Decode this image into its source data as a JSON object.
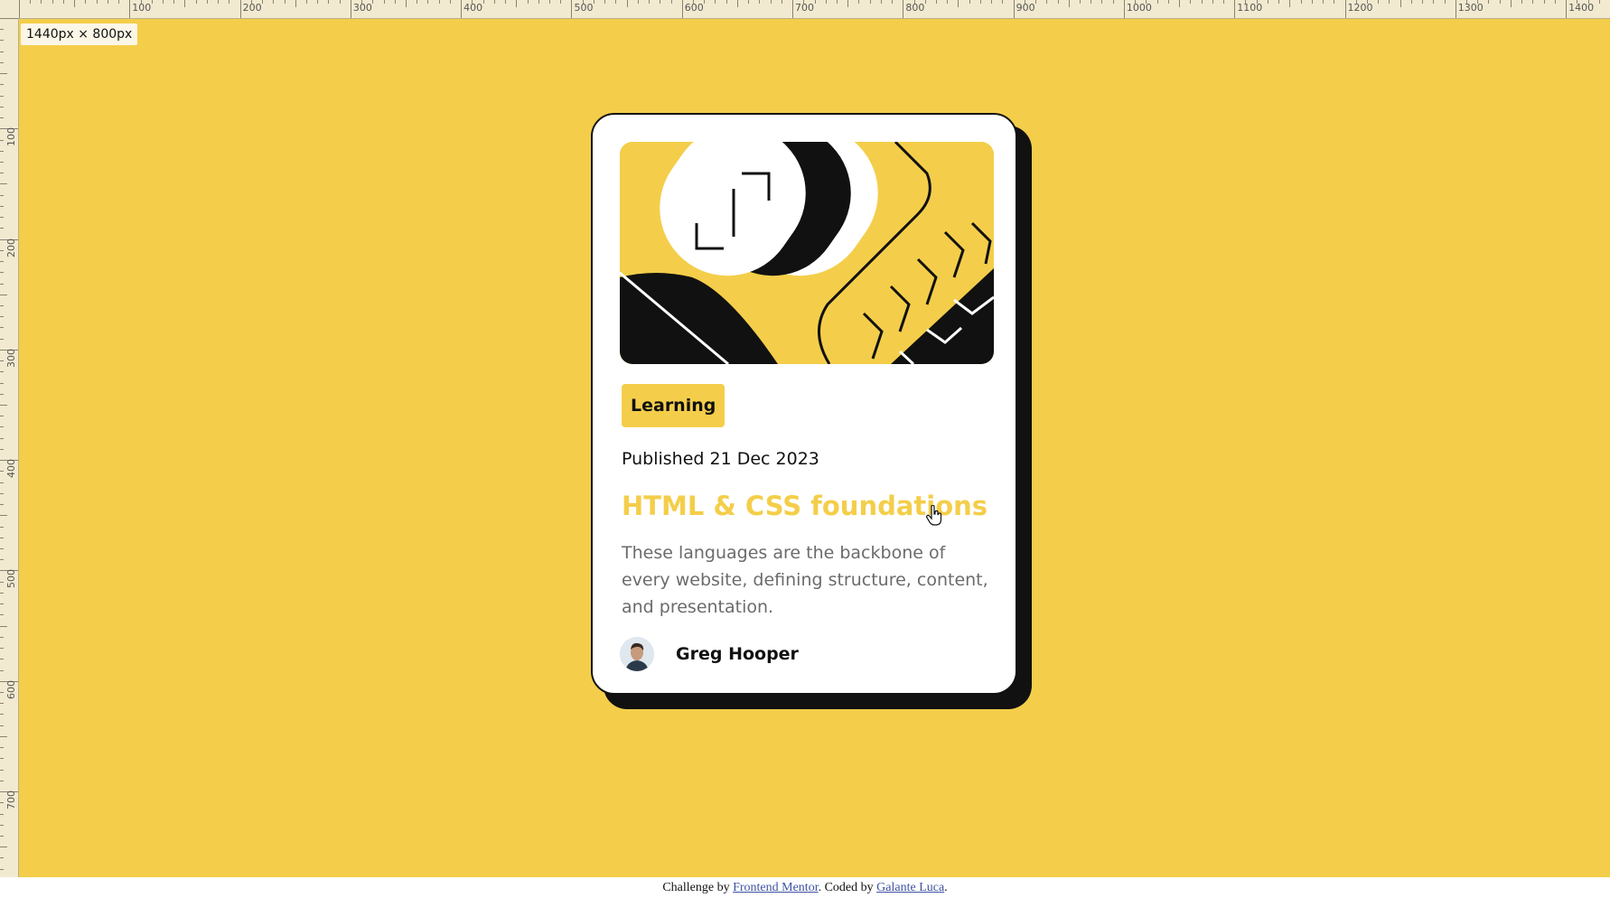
{
  "viewport_badge": "1440px × 800px",
  "ruler": {
    "top_labels": [
      "100",
      "200",
      "300",
      "400",
      "500",
      "600",
      "700",
      "800",
      "900",
      "1000",
      "1100",
      "1200",
      "1300",
      "1400"
    ],
    "left_labels": [
      "100",
      "200",
      "300",
      "400",
      "500",
      "600",
      "700"
    ]
  },
  "colors": {
    "page_background": "#f4ce4a",
    "card_background": "#ffffff",
    "card_border": "#111111",
    "title_color": "#f4ce4a",
    "tag_background": "#f4ce4a",
    "link_color": "#3e52a3"
  },
  "card": {
    "illustration": "blog-illustration",
    "tag": "Learning",
    "published": "Published 21 Dec 2023",
    "title": "HTML & CSS foundations",
    "description": "These languages are the backbone of every website, defining structure, content, and presentation.",
    "author": {
      "avatar": "avatar-icon",
      "name": "Greg Hooper"
    }
  },
  "attribution": {
    "prefix": "Challenge by ",
    "link1": "Frontend Mentor",
    "middle": ". Coded by ",
    "link2": "Galante Luca",
    "suffix": "."
  }
}
